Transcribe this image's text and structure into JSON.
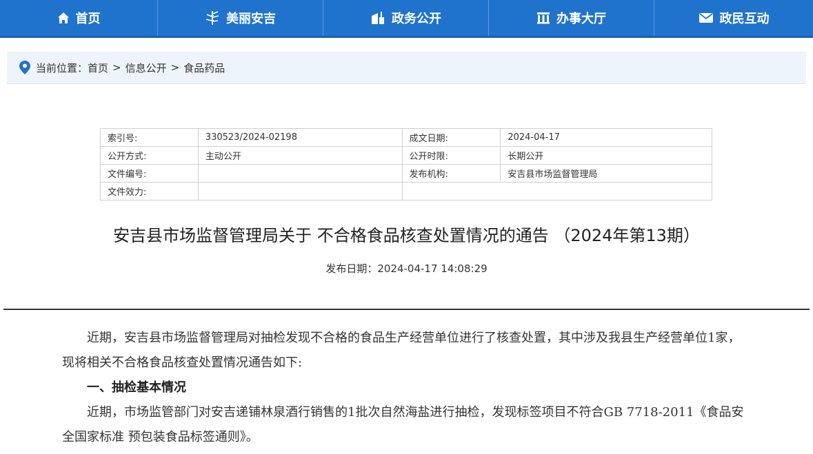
{
  "nav": {
    "items": [
      {
        "label": "首页",
        "icon": "home-icon"
      },
      {
        "label": "美丽安吉",
        "icon": "bamboo-icon"
      },
      {
        "label": "政务公开",
        "icon": "building-icon"
      },
      {
        "label": "办事大厅",
        "icon": "hall-icon"
      },
      {
        "label": "政民互动",
        "icon": "mail-icon"
      }
    ],
    "bg_color": "#1f73cc"
  },
  "breadcrumb": {
    "prefix": "当前位置：",
    "items": [
      "首页",
      "信息公开",
      "食品药品"
    ],
    "separator": ">"
  },
  "meta_table": {
    "rows": [
      [
        {
          "label": "索引号:",
          "value": "330523/2024-02198"
        },
        {
          "label": "成文日期:",
          "value": "2024-04-17"
        }
      ],
      [
        {
          "label": "公开方式:",
          "value": "主动公开"
        },
        {
          "label": "公开时限:",
          "value": "长期公开"
        }
      ],
      [
        {
          "label": "文件编号:",
          "value": ""
        },
        {
          "label": "发布机构:",
          "value": "安吉县市场监督管理局"
        }
      ],
      [
        {
          "label": "文件效力:",
          "value": ""
        },
        {
          "label": "",
          "value": ""
        }
      ]
    ]
  },
  "article": {
    "title": "安吉县市场监督管理局关于 不合格食品核查处置情况的通告 （2024年第13期）",
    "pub_date": "发布日期：2024-04-17 14:08:29",
    "paragraphs": [
      "近期，安吉县市场监督管理局对抽检发现不合格的食品生产经营单位进行了核查处置，其中涉及我县生产经营单位1家，现将相关不合格食品核查处置情况通告如下:",
      "一、抽检基本情况",
      "近期，市场监管部门对安吉递铺林泉酒行销售的1批次自然海盐进行抽检，发现标签项目不符合GB 7718-2011《食品安全国家标准 预包装食品标签通则》。"
    ]
  }
}
